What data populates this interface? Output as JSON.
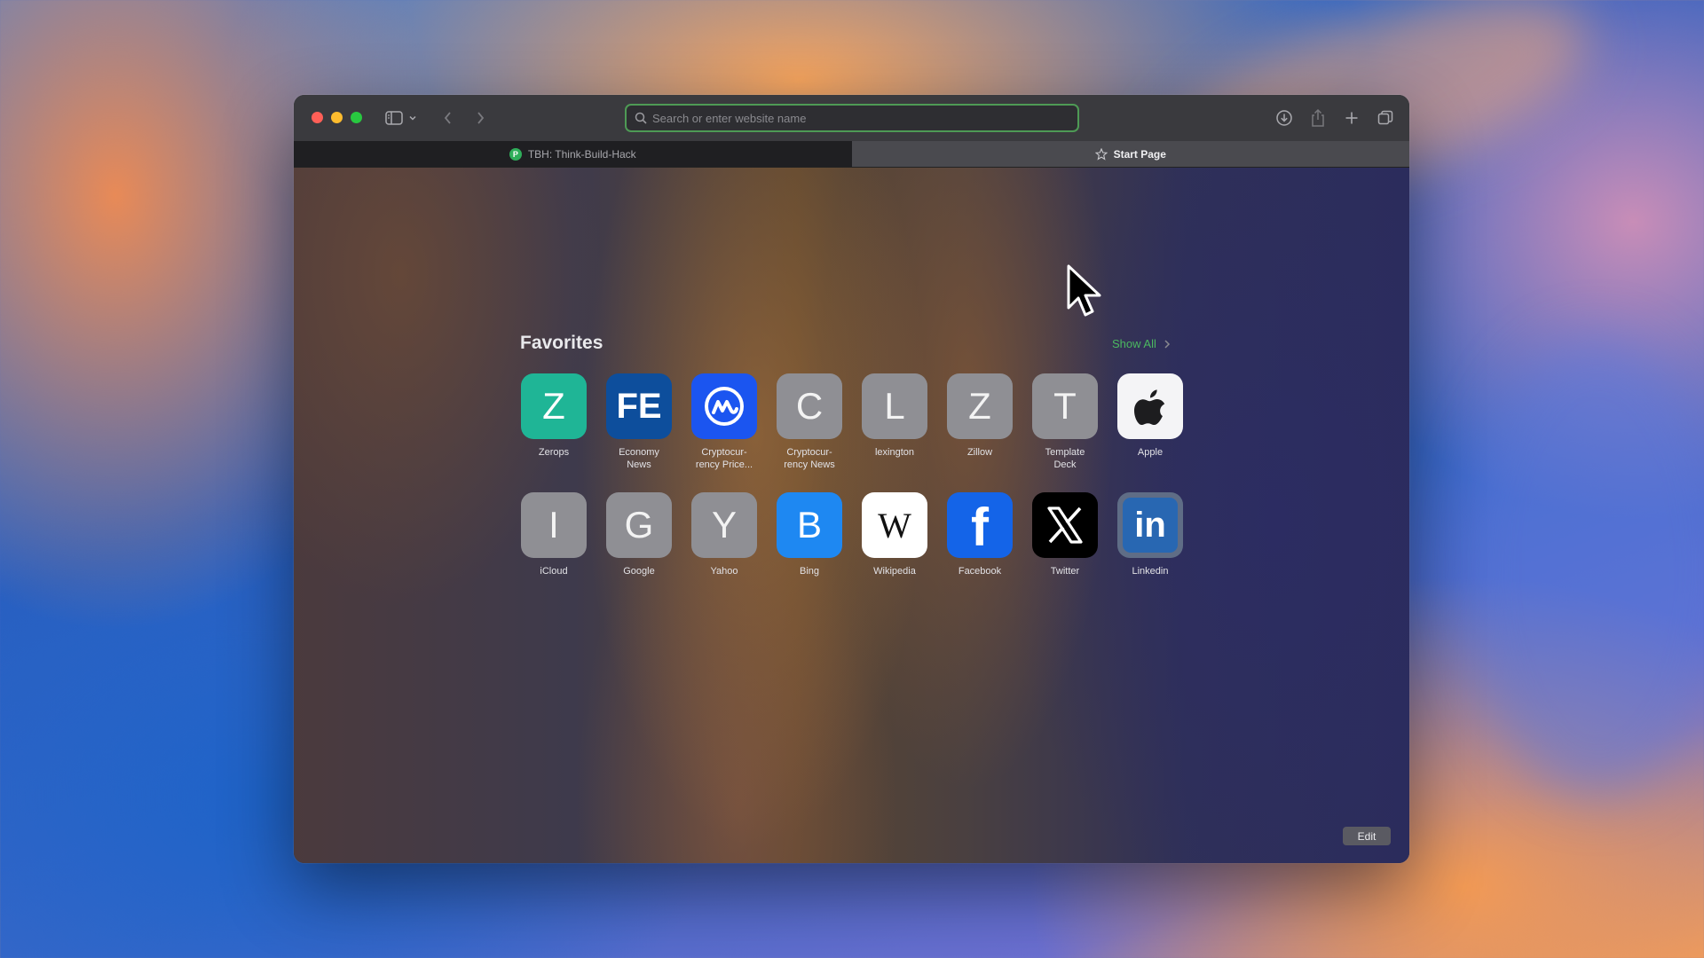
{
  "window": {
    "controls": [
      "close",
      "minimize",
      "zoom"
    ]
  },
  "toolbar": {
    "sidebar_icon": "sidebar-icon",
    "back_icon": "chevron-left-icon",
    "forward_icon": "chevron-right-icon",
    "download_icon": "download-icon",
    "share_icon": "share-icon",
    "new_tab_icon": "plus-icon",
    "tab_overview_icon": "tabs-overview-icon"
  },
  "address_bar": {
    "placeholder": "Search or enter website name",
    "value": ""
  },
  "tabs": [
    {
      "label": "TBH: Think-Build-Hack",
      "favicon": "P",
      "active": false
    },
    {
      "label": "Start Page",
      "icon": "star-icon",
      "active": true
    }
  ],
  "favorites": {
    "title": "Favorites",
    "show_all": "Show All",
    "items": [
      {
        "label": "Zerops",
        "glyph": "Z"
      },
      {
        "label": "Economy\nNews",
        "glyph": "FE"
      },
      {
        "label": "Cryptocur-\nrency Price...",
        "glyph": ""
      },
      {
        "label": "Cryptocur-\nrency News",
        "glyph": "C"
      },
      {
        "label": "lexington",
        "glyph": "L"
      },
      {
        "label": "Zillow",
        "glyph": "Z"
      },
      {
        "label": "Template\nDeck",
        "glyph": "T"
      },
      {
        "label": "Apple",
        "glyph": ""
      },
      {
        "label": "iCloud",
        "glyph": "I"
      },
      {
        "label": "Google",
        "glyph": "G"
      },
      {
        "label": "Yahoo",
        "glyph": "Y"
      },
      {
        "label": "Bing",
        "glyph": "B"
      },
      {
        "label": "Wikipedia",
        "glyph": "W"
      },
      {
        "label": "Facebook",
        "glyph": "f"
      },
      {
        "label": "Twitter",
        "glyph": "X"
      },
      {
        "label": "Linkedin",
        "glyph": "in"
      }
    ]
  },
  "edit_label": "Edit",
  "colors": {
    "accent_green": "#4bb860",
    "zerops": "#1fb596",
    "economy_news": "#0d4e9c",
    "coinmarketcap": "#1b55f0",
    "bing": "#1e88f2",
    "facebook": "#1464e8",
    "linkedin": "#2867b2"
  }
}
